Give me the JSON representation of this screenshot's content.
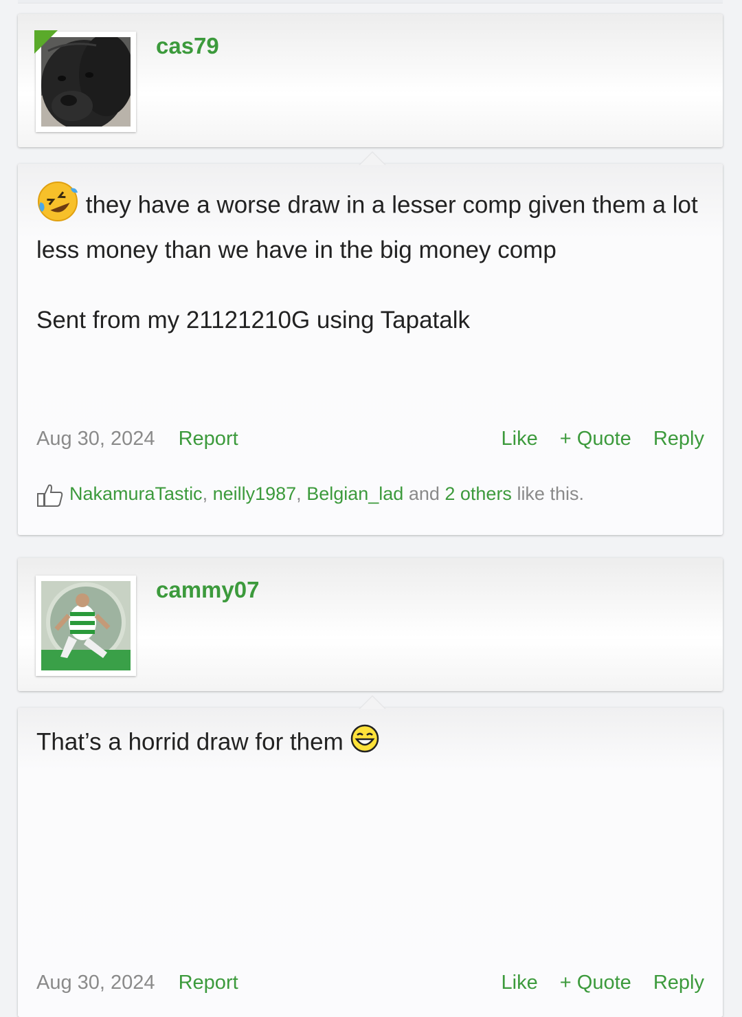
{
  "posts": [
    {
      "username": "cas79",
      "message_lines": [
        "they have a worse draw in a lesser comp given them a lot less money than we have in the big money comp",
        "Sent from my 21121210G using Tapatalk"
      ],
      "date": "Aug 30, 2024",
      "report": "Report",
      "actions": {
        "like": "Like",
        "quote": "+ Quote",
        "reply": "Reply"
      },
      "likes": {
        "names": [
          "NakamuraTastic",
          "neilly1987",
          "Belgian_lad"
        ],
        "sep": ", ",
        "and": " and ",
        "others": "2 others",
        "suffix": " like this."
      },
      "emoji": "rolling-on-floor-laughing-icon"
    },
    {
      "username": "cammy07",
      "message_lines": [
        "That’s a horrid draw for them"
      ],
      "date": "Aug 30, 2024",
      "report": "Report",
      "actions": {
        "like": "Like",
        "quote": "+ Quote",
        "reply": "Reply"
      },
      "emoji": "grinning-face-icon"
    }
  ],
  "colors": {
    "accent": "#3c9a3c",
    "muted": "#8a8a8a",
    "text": "#222222",
    "online": "#5aaa2a"
  }
}
